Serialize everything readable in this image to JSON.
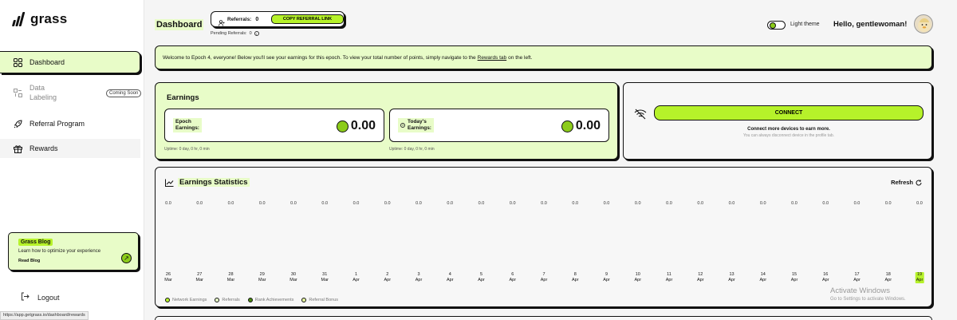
{
  "app": {
    "logo_text": "grass"
  },
  "sidebar": {
    "items": [
      {
        "label": "Dashboard"
      },
      {
        "label": "Data Labeling",
        "line1": "Data",
        "line2": "Labeling",
        "badge": "Coming Soon"
      },
      {
        "label": "Referral Program"
      },
      {
        "label": "Rewards"
      }
    ],
    "blog": {
      "tag": "Grass Blog",
      "description": "Learn how to optimize your experience",
      "link": "Read Blog"
    },
    "logout": "Logout"
  },
  "status_url": "https://app.getgrass.io/dashboard/rewards",
  "header": {
    "title": "Dashboard",
    "referrals_label": "Referrals:",
    "referrals_count": "0",
    "copy_button": "COPY REFERRAL LINK",
    "pending_label": "Pending Referrals:",
    "pending_count": "0",
    "theme_label": "Light theme",
    "greeting": "Hello, gentlewoman!"
  },
  "welcome": {
    "text_before": "Welcome to Epoch 4, everyone! Below you'll see your earnings for this epoch. To view your total number of points, simply navigate to the",
    "link": "Rewards tab",
    "text_after": "on the left."
  },
  "earnings": {
    "title": "Earnings",
    "epoch": {
      "line1": "Epoch",
      "line2": "Earnings:",
      "value": "0.00",
      "uptime": "Uptime: 0 day, 0 hr, 0 min"
    },
    "today": {
      "line1": "Today's",
      "line2": "Earnings:",
      "value": "0.00",
      "uptime": "Uptime: 0 day, 0 hr, 0 min"
    }
  },
  "connect": {
    "button": "CONNECT",
    "title": "Connect more devices to earn more.",
    "subtitle": "You can always disconnect device in the profile tab."
  },
  "stats": {
    "title": "Earnings Statistics",
    "refresh": "Refresh",
    "values": [
      "0.0",
      "0.0",
      "0.0",
      "0.0",
      "0.0",
      "0.0",
      "0.0",
      "0.0",
      "0.0",
      "0.0",
      "0.0",
      "0.0",
      "0.0",
      "0.0",
      "0.0",
      "0.0",
      "0.0",
      "0.0",
      "0.0",
      "0.0",
      "0.0",
      "0.0",
      "0.0",
      "0.0",
      "0.0"
    ],
    "days": [
      {
        "d": "26",
        "m": "Mar"
      },
      {
        "d": "27",
        "m": "Mar"
      },
      {
        "d": "28",
        "m": "Mar"
      },
      {
        "d": "29",
        "m": "Mar"
      },
      {
        "d": "30",
        "m": "Mar"
      },
      {
        "d": "31",
        "m": "Mar"
      },
      {
        "d": "1",
        "m": "Apr"
      },
      {
        "d": "2",
        "m": "Apr"
      },
      {
        "d": "3",
        "m": "Apr"
      },
      {
        "d": "4",
        "m": "Apr"
      },
      {
        "d": "5",
        "m": "Apr"
      },
      {
        "d": "6",
        "m": "Apr"
      },
      {
        "d": "7",
        "m": "Apr"
      },
      {
        "d": "8",
        "m": "Apr"
      },
      {
        "d": "9",
        "m": "Apr"
      },
      {
        "d": "10",
        "m": "Apr"
      },
      {
        "d": "11",
        "m": "Apr"
      },
      {
        "d": "12",
        "m": "Apr"
      },
      {
        "d": "13",
        "m": "Apr"
      },
      {
        "d": "14",
        "m": "Apr"
      },
      {
        "d": "15",
        "m": "Apr"
      },
      {
        "d": "16",
        "m": "Apr"
      },
      {
        "d": "17",
        "m": "Apr"
      },
      {
        "d": "18",
        "m": "Apr"
      },
      {
        "d": "19",
        "m": "Apr"
      }
    ],
    "active_day_index": 24,
    "legend": [
      {
        "label": "Network Earnings",
        "color": "#b6f22a"
      },
      {
        "label": "Referrals",
        "color": "#e8fcc8"
      },
      {
        "label": "Rank Achievements",
        "color": "#4c8c10"
      },
      {
        "label": "Referral Bonus",
        "color": "#e6f5a0"
      }
    ]
  },
  "watermark": {
    "line1": "Activate Windows",
    "line2": "Go to Settings to activate Windows."
  },
  "colors": {
    "accent": "#b6f22a",
    "accent_light": "#e8fcc8",
    "accent_dark": "#8ccc1a"
  }
}
